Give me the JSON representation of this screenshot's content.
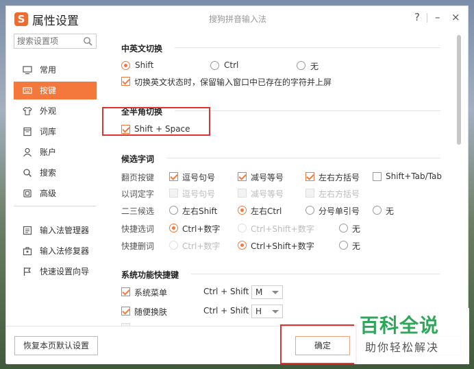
{
  "window": {
    "title": "属性设置",
    "app_name": "搜狗拼音输入法",
    "logo_letter": "S",
    "help": "?",
    "minimize": "–",
    "close": "×"
  },
  "sidebar": {
    "search_placeholder": "搜索设置项",
    "items": [
      {
        "label": "常用",
        "icon": "monitor-icon"
      },
      {
        "label": "按键",
        "icon": "keyboard-icon",
        "active": true
      },
      {
        "label": "外观",
        "icon": "shirt-icon"
      },
      {
        "label": "词库",
        "icon": "book-icon"
      },
      {
        "label": "账户",
        "icon": "user-icon"
      },
      {
        "label": "搜索",
        "icon": "search-icon"
      },
      {
        "label": "高级",
        "icon": "square-icon"
      },
      {
        "label": "输入法管理器",
        "icon": "manager-icon"
      },
      {
        "label": "输入法修复器",
        "icon": "toolbox-icon"
      },
      {
        "label": "快速设置向导",
        "icon": "flag-icon"
      }
    ]
  },
  "cn_en_switch": {
    "title": "中英文切换",
    "options": [
      "Shift",
      "Ctrl",
      "无"
    ],
    "selected": "Shift",
    "keep_text_label": "切换英文状态时，保留输入窗口中已存在的字符并上屏",
    "keep_text_checked": true
  },
  "full_half": {
    "title": "全半角切换",
    "label": "Shift + Space",
    "checked": true
  },
  "candidates": {
    "title": "候选字词",
    "rows": [
      {
        "label": "翻页按键",
        "items": [
          {
            "text": "逗号句号",
            "checked": true
          },
          {
            "text": "减号等号",
            "checked": true
          },
          {
            "text": "左右方括号",
            "checked": true
          },
          {
            "text": "Shift+Tab/Tab",
            "checked": false
          }
        ]
      },
      {
        "label": "以词定字",
        "items": [
          {
            "text": "逗号句号"
          },
          {
            "text": "减号等号"
          },
          {
            "text": "左右方括号"
          }
        ]
      },
      {
        "label": "二三候选",
        "items": [
          {
            "text": "左右Shift",
            "selected": false
          },
          {
            "text": "左右Ctrl",
            "selected": true
          },
          {
            "text": "分号单引号",
            "selected": false
          },
          {
            "text": "无",
            "selected": false
          }
        ]
      },
      {
        "label": "快捷选词",
        "items": [
          {
            "text": "Ctrl+数字",
            "selected": true
          },
          {
            "text": "Ctrl+Shift+数字",
            "selected": false
          },
          {
            "text": "无",
            "selected": false
          }
        ]
      },
      {
        "label": "快捷删词",
        "items": [
          {
            "text": "Ctrl+数字",
            "selected": false
          },
          {
            "text": "Ctrl+Shift+数字",
            "selected": true
          },
          {
            "text": "无",
            "selected": false
          }
        ]
      }
    ]
  },
  "sys_shortcuts": {
    "title": "系统功能快捷键",
    "rows": [
      {
        "label": "系统菜单",
        "checked": true,
        "combo": "Ctrl + Shift +",
        "key": "M"
      },
      {
        "label": "随便换肤",
        "checked": true,
        "combo": "Ctrl + Shift +",
        "key": "H"
      }
    ]
  },
  "footer": {
    "restore_label": "恢复本页默认设置",
    "ok_label": "确定"
  },
  "watermark": {
    "main": "百科全说",
    "sub": "助你轻松解决"
  },
  "colors": {
    "accent": "#f4783c",
    "highlight": "#e0322f",
    "watermark_green": "#2fa75a"
  }
}
